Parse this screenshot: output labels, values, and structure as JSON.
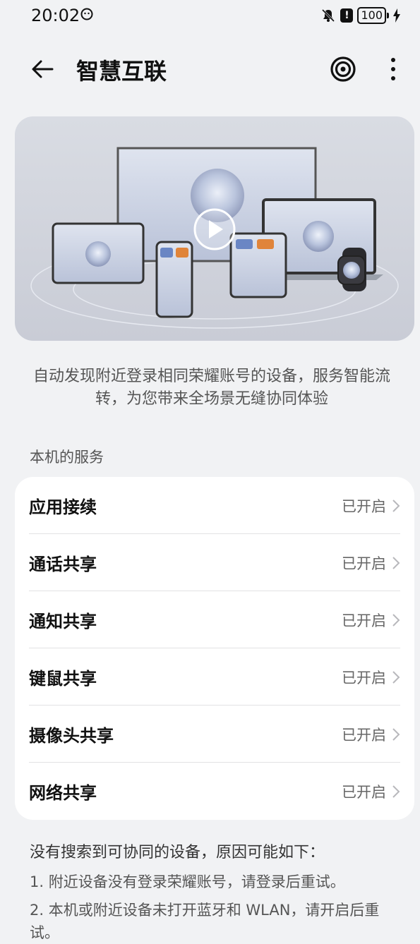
{
  "status": {
    "time": "20:02",
    "battery": "100"
  },
  "header": {
    "title": "智慧互联"
  },
  "intro": {
    "description": "自动发现附近登录相同荣耀账号的设备，服务智能流转，为您带来全场景无缝协同体验"
  },
  "services": {
    "section_title": "本机的服务",
    "items": [
      {
        "name": "应用接续",
        "state": "已开启"
      },
      {
        "name": "通话共享",
        "state": "已开启"
      },
      {
        "name": "通知共享",
        "state": "已开启"
      },
      {
        "name": "键鼠共享",
        "state": "已开启"
      },
      {
        "name": "摄像头共享",
        "state": "已开启"
      },
      {
        "name": "网络共享",
        "state": "已开启"
      }
    ]
  },
  "notes": {
    "title": "没有搜索到可协同的设备，原因可能如下：",
    "items": [
      "1. 附近设备没有登录荣耀账号，请登录后重试。",
      "2. 本机或附近设备未打开蓝牙和 WLAN，请开启后重试。"
    ]
  },
  "colors": {
    "background": "#f1f2f4",
    "card": "#ffffff",
    "text": "#111111",
    "secondary": "#666666"
  }
}
